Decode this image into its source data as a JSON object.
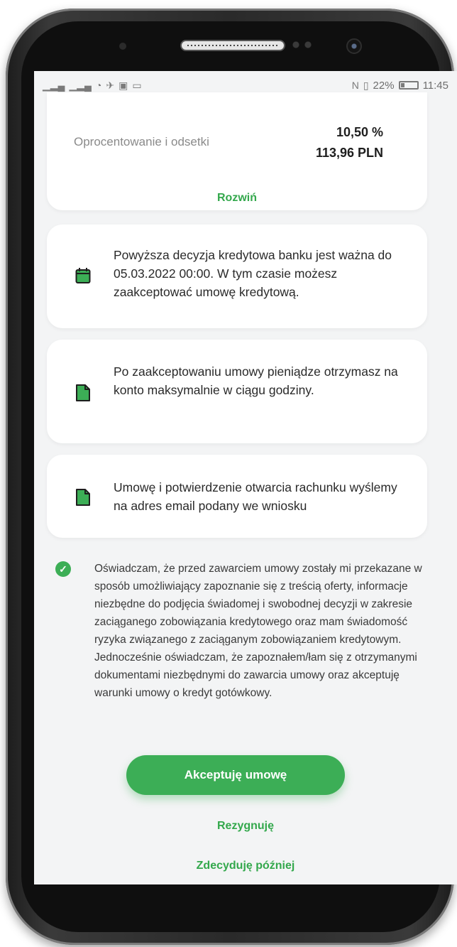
{
  "statusbar": {
    "left_icons": [
      "signal-icon",
      "signal-icon",
      "wifi-icon",
      "airplane-icon",
      "app-icon",
      "cast-icon"
    ],
    "battery_percent": "22%",
    "time": "11:45"
  },
  "rate_card": {
    "label": "Oprocentowanie i odsetki",
    "rate": "10,50 %",
    "amount": "113,96 PLN",
    "expand_link": "Rozwiń"
  },
  "info_cards": [
    {
      "icon": "calendar-icon",
      "text": "Powyższa decyzja kredytowa banku jest ważna do 05.03.2022 00:00. W tym czasie możesz zaakceptować umowę kredytową."
    },
    {
      "icon": "document-icon",
      "text": "Po zaakceptowaniu umowy pieniądze otrzymasz na konto maksymalnie w ciągu godziny."
    },
    {
      "icon": "document-icon",
      "text": "Umowę i potwierdzenie otwarcia rachunku wyślemy na adres email podany we wniosku"
    }
  ],
  "consent": {
    "checked": true,
    "text": "Oświadczam, że przed zawarciem umowy zostały mi przekazane w sposób umożliwiający zapoznanie się z treścią oferty, informacje niezbędne do podjęcia świadomej i swobodnej decyzji w zakresie zaciąganego zobowiązania kredytowego oraz mam świadomość ryzyka związanego z zaciąganym zobowiązaniem kredytowym. Jednocześnie oświadczam, że zapoznałem/łam się z otrzymanymi dokumentami niezbędnymi do zawarcia umowy oraz akceptuję warunki umowy o kredyt gotówkowy."
  },
  "actions": {
    "accept": "Akceptuję umowę",
    "resign": "Rezygnuję",
    "later": "Zdecyduję później"
  },
  "colors": {
    "accent": "#3cae56",
    "background": "#f3f4f5",
    "card": "#ffffff"
  }
}
